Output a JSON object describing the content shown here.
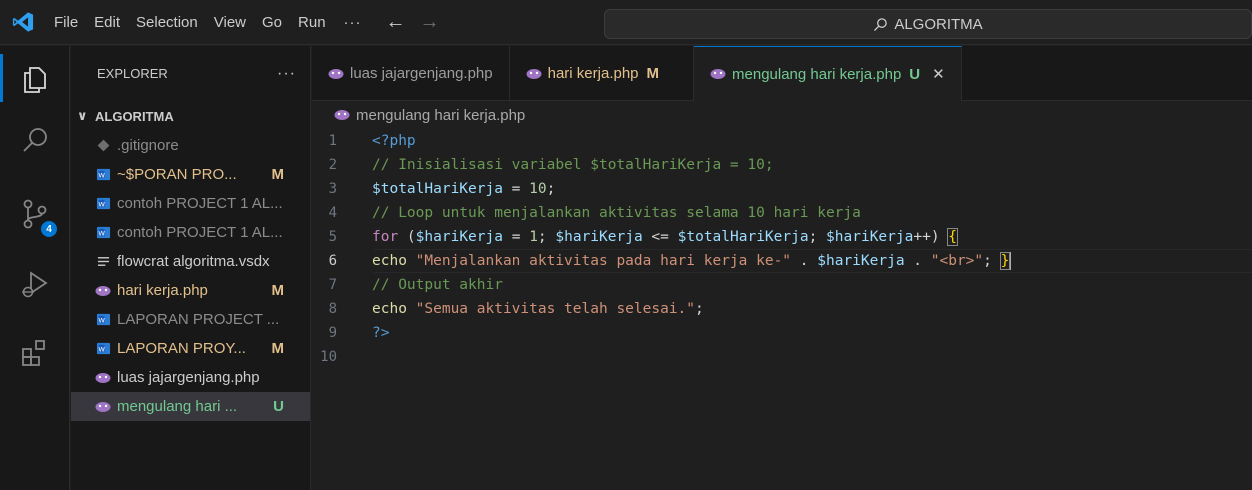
{
  "menu": {
    "items": [
      "File",
      "Edit",
      "Selection",
      "View",
      "Go",
      "Run"
    ],
    "more": "···"
  },
  "search": {
    "text": "ALGORITMA"
  },
  "activity": {
    "scm_badge": "4"
  },
  "explorer": {
    "title": "EXPLORER",
    "more": "···",
    "folder": "ALGORITMA",
    "files": [
      {
        "name": ".gitignore",
        "status": "",
        "kind": "git"
      },
      {
        "name": "~$PORAN PRO...",
        "status": "M",
        "kind": "word"
      },
      {
        "name": "contoh PROJECT 1 AL...",
        "status": "",
        "kind": "word"
      },
      {
        "name": "contoh PROJECT 1 AL...",
        "status": "",
        "kind": "word"
      },
      {
        "name": "flowcrat algoritma.vsdx",
        "status": "",
        "kind": "text"
      },
      {
        "name": "hari kerja.php",
        "status": "M",
        "kind": "php"
      },
      {
        "name": "LAPORAN PROJECT ...",
        "status": "",
        "kind": "word"
      },
      {
        "name": "LAPORAN PROY...",
        "status": "M",
        "kind": "word"
      },
      {
        "name": "luas jajargenjang.php",
        "status": "",
        "kind": "php"
      },
      {
        "name": "mengulang hari ...",
        "status": "U",
        "kind": "php"
      }
    ]
  },
  "tabs": [
    {
      "label": "luas jajargenjang.php",
      "mark": ""
    },
    {
      "label": "hari kerja.php",
      "mark": "M"
    },
    {
      "label": "mengulang hari kerja.php",
      "mark": "U",
      "close": "✕"
    }
  ],
  "breadcrumb": {
    "file": "mengulang hari kerja.php"
  },
  "code": {
    "line_numbers": [
      "1",
      "2",
      "3",
      "4",
      "5",
      "6",
      "7",
      "8",
      "9",
      "10"
    ],
    "current_line": "6",
    "l1": {
      "open": "<?php"
    },
    "l2": {
      "comment": "// Inisialisasi variabel $totalHariKerja = 10;"
    },
    "l3": {
      "var": "$totalHariKerja",
      "eq": " = ",
      "num": "10",
      "end": ";"
    },
    "l4": {
      "comment": "// Loop untuk menjalankan aktivitas selama 10 hari kerja"
    },
    "l5": {
      "kw": "for",
      "p1": " (",
      "v1": "$hariKerja",
      "o1": " = ",
      "n1": "1",
      "s1": "; ",
      "v2": "$hariKerja",
      "o2": " <= ",
      "v3": "$totalHariKerja",
      "s2": "; ",
      "v4": "$hariKerja",
      "o3": "++) ",
      "brace": "{"
    },
    "l6": {
      "echo": "echo",
      "sp": " ",
      "str1": "\"Menjalankan aktivitas pada hari kerja ke-\"",
      "dot1": " . ",
      "var": "$hariKerja",
      "dot2": " . ",
      "str2": "\"<br>\"",
      "semi": "; ",
      "brace": "}"
    },
    "l7": {
      "comment": "// Output akhir"
    },
    "l8": {
      "echo": "echo",
      "sp": " ",
      "str": "\"Semua aktivitas telah selesai.\"",
      "semi": ";"
    },
    "l9": {
      "close": "?>"
    }
  }
}
